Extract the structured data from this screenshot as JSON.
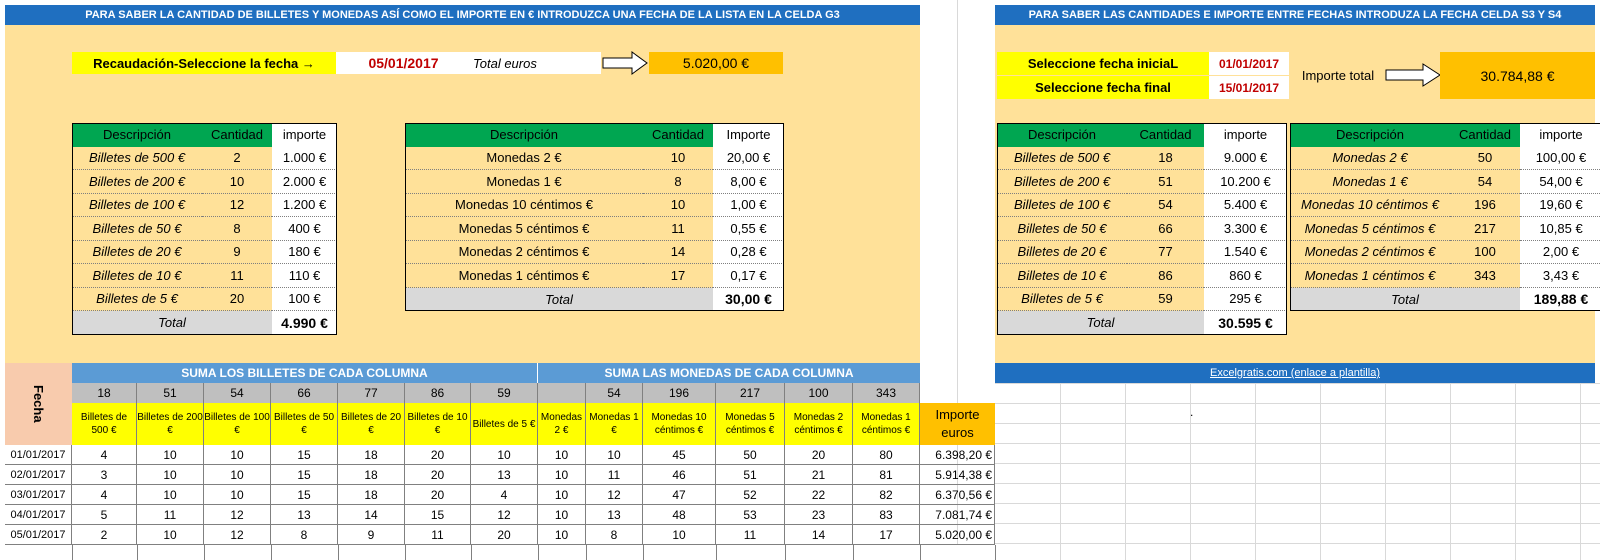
{
  "left": {
    "banner": "PARA SABER LA CANTIDAD DE BILLETES Y MONEDAS ASÍ COMO EL IMPORTE EN € INTRODUZCA UNA FECHA DE LA LISTA  EN LA CELDA G3",
    "select_label": "Recaudación-Seleccione la fecha  →",
    "date_value": "05/01/2017",
    "total_label": "Total euros",
    "total_value": "5.020,00 €",
    "bills_headers": [
      "Descripción",
      "Cantidad",
      "importe"
    ],
    "bills": [
      [
        "Billetes de 500 €",
        "2",
        "1.000 €"
      ],
      [
        "Billetes de 200 €",
        "10",
        "2.000 €"
      ],
      [
        "Billetes de 100 €",
        "12",
        "1.200 €"
      ],
      [
        "Billetes de 50 €",
        "8",
        "400 €"
      ],
      [
        "Billetes de 20 €",
        "9",
        "180 €"
      ],
      [
        "Billetes de 10 €",
        "11",
        "110 €"
      ],
      [
        "Billetes de 5 €",
        "20",
        "100 €"
      ]
    ],
    "bills_total_label": "Total",
    "bills_total": "4.990 €",
    "coins_headers": [
      "Descripción",
      "Cantidad",
      "Importe"
    ],
    "coins": [
      [
        "Monedas 2 €",
        "10",
        "20,00 €"
      ],
      [
        "Monedas 1 €",
        "8",
        "8,00 €"
      ],
      [
        "Monedas 10 céntimos €",
        "10",
        "1,00 €"
      ],
      [
        "Monedas 5 céntimos €",
        "11",
        "0,55 €"
      ],
      [
        "Monedas 2 céntimos €",
        "14",
        "0,28 €"
      ],
      [
        "Monedas 1 céntimos  €",
        "17",
        "0,17 €"
      ]
    ],
    "coins_total_label": "Total",
    "coins_total": "30,00 €"
  },
  "right": {
    "banner": "PARA SABER LAS CANTIDADES E IMPORTE ENTRE FECHAS INTRODUZA LA FECHA CELDA S3 Y S4",
    "start_label": "Seleccione fecha iniciaL",
    "start_value": "01/01/2017",
    "end_label": "Seleccione fecha final",
    "end_value": "15/01/2017",
    "importe_label": "Importe total",
    "importe_value": "30.784,88 €",
    "bills_headers": [
      "Descripción",
      "Cantidad",
      "importe"
    ],
    "bills": [
      [
        "Billetes de 500 €",
        "18",
        "9.000 €"
      ],
      [
        "Billetes de 200 €",
        "51",
        "10.200 €"
      ],
      [
        "Billetes de 100 €",
        "54",
        "5.400 €"
      ],
      [
        "Billetes de 50 €",
        "66",
        "3.300 €"
      ],
      [
        "Billetes de 20 €",
        "77",
        "1.540 €"
      ],
      [
        "Billetes de 10 €",
        "86",
        "860 €"
      ],
      [
        "Billetes de 5 €",
        "59",
        "295 €"
      ]
    ],
    "bills_total_label": "Total",
    "bills_total": "30.595 €",
    "coins_headers": [
      "Descripción",
      "Cantidad",
      "importe"
    ],
    "coins": [
      [
        "Monedas 2 €",
        "50",
        "100,00 €"
      ],
      [
        "Monedas 1 €",
        "54",
        "54,00 €"
      ],
      [
        "Monedas 10 céntimos €",
        "196",
        "19,60 €"
      ],
      [
        "Monedas 5 céntimos €",
        "217",
        "10,85 €"
      ],
      [
        "Monedas 2 céntimos €",
        "100",
        "2,00 €"
      ],
      [
        "Monedas 1 céntimos  €",
        "343",
        "3,43 €"
      ]
    ],
    "coins_total_label": "Total",
    "coins_total": "189,88 €",
    "link": "Excelgratis.com  (enlace a plantilla)"
  },
  "bottom": {
    "fecha_label": "Fecha",
    "bills_banner": "SUMA LOS BILLETES DE CADA COLUMNA",
    "coins_banner": "SUMA LAS MONEDAS DE CADA COLUMNA",
    "sums": [
      "18",
      "51",
      "54",
      "66",
      "77",
      "86",
      "59",
      "",
      "54",
      "196",
      "217",
      "100",
      "343"
    ],
    "col_headers": [
      "Billetes de 500 €",
      "Billetes de 200 €",
      "Billetes de 100 €",
      "Billetes de 50 €",
      "Billetes de 20 €",
      "Billetes de 10 €",
      "Billetes de 5 €",
      "Monedas 2 €",
      "Monedas 1 €",
      "Monedas 10 céntimos €",
      "Monedas 5 céntimos €",
      "Monedas 2 céntimos €",
      "Monedas 1 céntimos €"
    ],
    "importe_header": "Importe euros",
    "rows": [
      {
        "date": "01/01/2017",
        "vals": [
          "4",
          "10",
          "10",
          "15",
          "18",
          "20",
          "10",
          "10",
          "10",
          "45",
          "50",
          "20",
          "80"
        ],
        "total": "6.398,20 €"
      },
      {
        "date": "02/01/2017",
        "vals": [
          "3",
          "10",
          "10",
          "15",
          "18",
          "20",
          "13",
          "10",
          "11",
          "46",
          "51",
          "21",
          "81"
        ],
        "total": "5.914,38 €"
      },
      {
        "date": "03/01/2017",
        "vals": [
          "4",
          "10",
          "10",
          "15",
          "18",
          "20",
          "4",
          "10",
          "12",
          "47",
          "52",
          "22",
          "82"
        ],
        "total": "6.370,56 €"
      },
      {
        "date": "04/01/2017",
        "vals": [
          "5",
          "11",
          "12",
          "13",
          "14",
          "15",
          "12",
          "10",
          "13",
          "48",
          "53",
          "23",
          "83"
        ],
        "total": "7.081,74 €"
      },
      {
        "date": "05/01/2017",
        "vals": [
          "2",
          "10",
          "12",
          "8",
          "9",
          "11",
          "20",
          "10",
          "8",
          "10",
          "11",
          "14",
          "17"
        ],
        "total": "5.020,00 €"
      }
    ],
    "dot": "."
  }
}
